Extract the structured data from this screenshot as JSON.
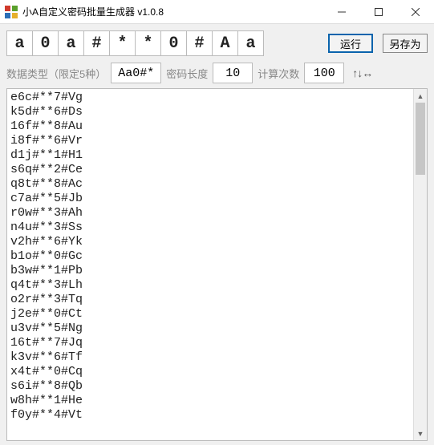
{
  "window": {
    "title": "小A自定义密码批量生成器 v1.0.8"
  },
  "toolbar": {
    "cells": [
      "a",
      "0",
      "a",
      "#",
      "*",
      "*",
      "0",
      "#",
      "A",
      "a"
    ],
    "run_label": "运行",
    "save_as_label": "另存为"
  },
  "settings": {
    "data_type_label": "数据类型（限定5种）",
    "data_type_value": "Aa0#*",
    "pwd_length_label": "密码长度",
    "pwd_length_value": "10",
    "calc_count_label": "计算次数",
    "calc_count_value": "100",
    "arrows": "↑↓↔"
  },
  "output_lines": [
    "e6c#**7#Vg",
    "k5d#**6#Ds",
    "16f#**8#Au",
    "i8f#**6#Vr",
    "d1j#**1#H1",
    "s6q#**2#Ce",
    "q8t#**8#Ac",
    "c7a#**5#Jb",
    "r0w#**3#Ah",
    "n4u#**3#Ss",
    "v2h#**6#Yk",
    "b1o#**0#Gc",
    "b3w#**1#Pb",
    "q4t#**3#Lh",
    "o2r#**3#Tq",
    "j2e#**0#Ct",
    "u3v#**5#Ng",
    "16t#**7#Jq",
    "k3v#**6#Tf",
    "x4t#**0#Cq",
    "s6i#**8#Qb",
    "w8h#**1#He",
    "f0y#**4#Vt"
  ]
}
